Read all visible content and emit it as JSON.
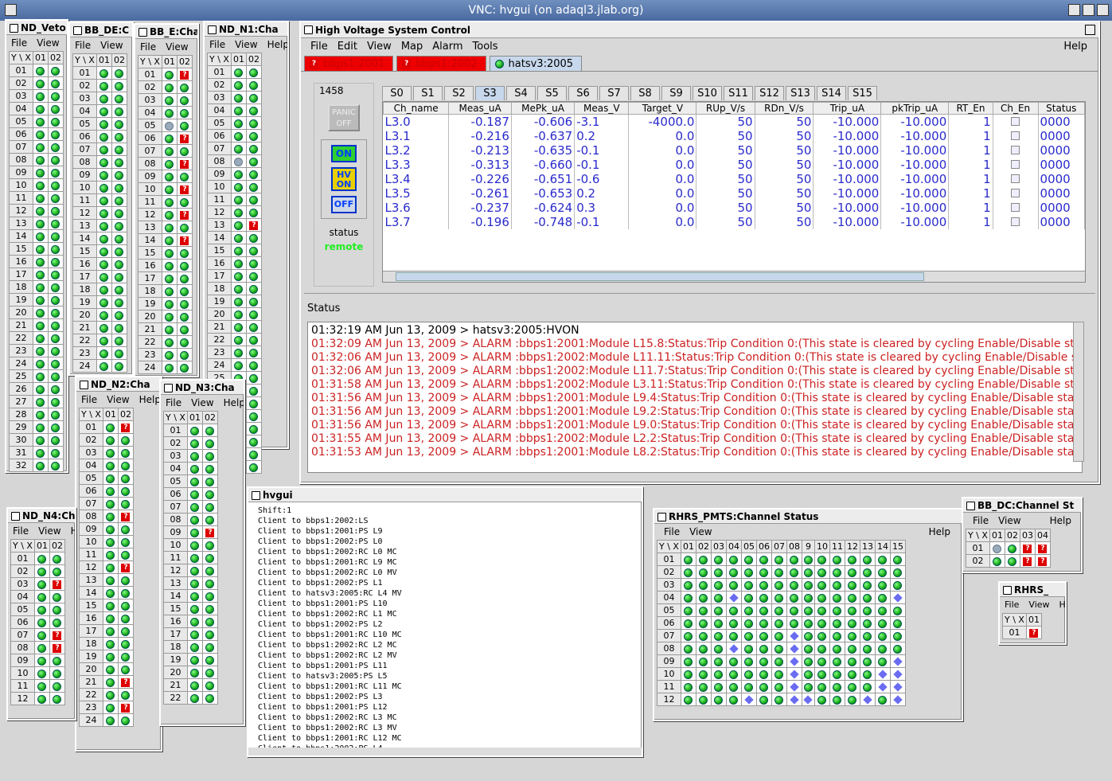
{
  "vnc_title": "VNC: hvgui (on adaql3.jlab.org)",
  "hv": {
    "title": "High Voltage System Control",
    "menu": [
      "File",
      "Edit",
      "View",
      "Map",
      "Alarm",
      "Tools"
    ],
    "help": "Help",
    "crates": [
      {
        "label": "bbps1:2001",
        "state": "error"
      },
      {
        "label": "bbps1:2002",
        "state": "error"
      },
      {
        "label": "hatsv3:2005",
        "state": "ok"
      }
    ],
    "crate_id": "1458",
    "panic_label": "PANIC OFF",
    "on_label": "ON",
    "hvon_label": "HV ON",
    "off_label": "OFF",
    "status_label": "status",
    "status_value": "remote",
    "slots": [
      "S0",
      "S1",
      "S2",
      "S3",
      "S4",
      "S5",
      "S6",
      "S7",
      "S8",
      "S9",
      "S10",
      "S11",
      "S12",
      "S13",
      "S14",
      "S15"
    ],
    "selected_slot": "S3",
    "columns": [
      "Ch_name",
      "Meas_uA",
      "MePk_uA",
      "Meas_V",
      "Target_V",
      "RUp_V/s",
      "RDn_V/s",
      "Trip_uA",
      "pkTrip_uA",
      "RT_En",
      "Ch_En",
      "Status"
    ],
    "rows": [
      [
        "L3.0",
        "-0.187",
        "-0.606",
        "-3.1",
        "-4000.0",
        "50",
        "50",
        "-10.000",
        "-10.000",
        "1",
        "",
        "0000"
      ],
      [
        "L3.1",
        "-0.216",
        "-0.637",
        "0.2",
        "0.0",
        "50",
        "50",
        "-10.000",
        "-10.000",
        "1",
        "",
        "0000"
      ],
      [
        "L3.2",
        "-0.213",
        "-0.635",
        "-0.1",
        "0.0",
        "50",
        "50",
        "-10.000",
        "-10.000",
        "1",
        "",
        "0000"
      ],
      [
        "L3.3",
        "-0.313",
        "-0.660",
        "-0.1",
        "0.0",
        "50",
        "50",
        "-10.000",
        "-10.000",
        "1",
        "",
        "0000"
      ],
      [
        "L3.4",
        "-0.226",
        "-0.651",
        "-0.6",
        "0.0",
        "50",
        "50",
        "-10.000",
        "-10.000",
        "1",
        "",
        "0000"
      ],
      [
        "L3.5",
        "-0.261",
        "-0.653",
        "0.2",
        "0.0",
        "50",
        "50",
        "-10.000",
        "-10.000",
        "1",
        "",
        "0000"
      ],
      [
        "L3.6",
        "-0.237",
        "-0.624",
        "0.3",
        "0.0",
        "50",
        "50",
        "-10.000",
        "-10.000",
        "1",
        "",
        "0000"
      ],
      [
        "L3.7",
        "-0.196",
        "-0.748",
        "-0.1",
        "0.0",
        "50",
        "50",
        "-10.000",
        "-10.000",
        "1",
        "",
        "0000"
      ]
    ],
    "status_header": "Status",
    "log": [
      {
        "text": "01:32:19 AM Jun 13, 2009 > hatsv3:2005:HVON",
        "color": "#000000"
      },
      {
        "text": "01:32:09 AM Jun 13, 2009 > ALARM :bbps1:2001:Module L15.8:Status:Trip Condition 0:(This state is cleared by cycling Enable/Disable status",
        "color": "#cc2222"
      },
      {
        "text": "01:32:06 AM Jun 13, 2009 > ALARM :bbps1:2002:Module L11.11:Status:Trip Condition 0:(This state is cleared by cycling Enable/Disable statu",
        "color": "#cc2222"
      },
      {
        "text": "01:32:06 AM Jun 13, 2009 > ALARM :bbps1:2002:Module L11.7:Status:Trip Condition 0:(This state is cleared by cycling Enable/Disable status",
        "color": "#cc2222"
      },
      {
        "text": "01:31:58 AM Jun 13, 2009 > ALARM :bbps1:2002:Module L3.11:Status:Trip Condition 0:(This state is cleared by cycling Enable/Disable status",
        "color": "#cc2222"
      },
      {
        "text": "01:31:56 AM Jun 13, 2009 > ALARM :bbps1:2001:Module L9.4:Status:Trip Condition 0:(This state is cleared by cycling Enable/Disable status)",
        "color": "#cc2222"
      },
      {
        "text": "01:31:56 AM Jun 13, 2009 > ALARM :bbps1:2001:Module L9.2:Status:Trip Condition 0:(This state is cleared by cycling Enable/Disable status)",
        "color": "#cc2222"
      },
      {
        "text": "01:31:56 AM Jun 13, 2009 > ALARM :bbps1:2001:Module L9.0:Status:Trip Condition 0:(This state is cleared by cycling Enable/Disable status)",
        "color": "#cc2222"
      },
      {
        "text": "01:31:55 AM Jun 13, 2009 > ALARM :bbps1:2002:Module L2.2:Status:Trip Condition 0:(This state is cleared by cycling Enable/Disable status)",
        "color": "#cc2222"
      },
      {
        "text": "01:31:53 AM Jun 13, 2009 > ALARM :bbps1:2001:Module L8.2:Status:Trip Condition 0:(This state is cleared by cycling Enable/Disable status)",
        "color": "#cc2222"
      }
    ]
  },
  "hvgui": {
    "title": "hvgui",
    "lines": [
      "Shift:1",
      "Client to bbps1:2002:LS",
      "Client to bbps1:2001:PS L9",
      "Client to bbps1:2002:PS L0",
      "Client to bbps1:2002:RC L0 MC",
      "Client to bbps1:2001:RC L9 MC",
      "Client to bbps1:2002:RC L0 MV",
      "Client to bbps1:2002:PS L1",
      "Client to hatsv3:2005:RC L4 MV",
      "Client to bbps1:2001:PS L10",
      "Client to bbps1:2002:RC L1 MC",
      "Client to bbps1:2002:PS L2",
      "Client to bbps1:2001:RC L10 MC",
      "Client to bbps1:2002:RC L2 MC",
      "Client to bbps1:2002:RC L2 MV",
      "Client to bbps1:2001:PS L11",
      "Client to hatsv3:2005:PS L5",
      "Client to bbps1:2001:RC L11 MC",
      "Client to bbps1:2002:PS L3",
      "Client to bbps1:2001:PS L12",
      "Client to bbps1:2002:RC L3 MC",
      "Client to bbps1:2002:RC L3 MV",
      "Client to bbps1:2001:RC L12 MC",
      "Client to bbps1:2002:PS L4"
    ]
  },
  "small_windows": {
    "nd_veto": {
      "title": "ND_Veto:",
      "menu": [
        "File",
        "View",
        "H"
      ]
    },
    "bb_de": {
      "title": "BB_DE:C",
      "menu": [
        "File",
        "View"
      ]
    },
    "bb_e": {
      "title": "BB_E:Cha",
      "menu": [
        "File",
        "View",
        "H"
      ]
    },
    "nd_n1": {
      "title": "ND_N1:Cha",
      "menu": [
        "File",
        "View",
        "Help"
      ]
    },
    "nd_n2": {
      "title": "ND_N2:Cha",
      "menu": [
        "File",
        "View",
        "Help"
      ]
    },
    "nd_n3": {
      "title": "ND_N3:Cha",
      "menu": [
        "File",
        "View",
        "Help"
      ]
    },
    "nd_n4": {
      "title": "ND_N4:Ch",
      "menu": [
        "File",
        "View",
        "H"
      ]
    },
    "rhrs_pmts": {
      "title": "RHRS_PMTS:Channel Status",
      "menu": [
        "File",
        "View"
      ],
      "help": "Help"
    },
    "bb_dc": {
      "title": "BB_DC:Channel St",
      "menu": [
        "File",
        "View"
      ],
      "help": "Help"
    },
    "rhrs": {
      "title": "RHRS_",
      "menu": [
        "File",
        "View",
        "Help"
      ]
    }
  },
  "grid_header": "Y \\ X",
  "col_labels": [
    "01",
    "02",
    "03",
    "04",
    "05",
    "06",
    "07",
    "08",
    "9",
    "10",
    "11",
    "12",
    "13",
    "14",
    "15"
  ],
  "row_labels": [
    "01",
    "02",
    "03",
    "04",
    "05",
    "06",
    "07",
    "08",
    "09",
    "10",
    "11",
    "12",
    "13",
    "14",
    "15",
    "16",
    "17",
    "18",
    "19",
    "20",
    "21",
    "22",
    "23",
    "24",
    "25",
    "26",
    "27",
    "28",
    "29",
    "30",
    "31",
    "32"
  ]
}
